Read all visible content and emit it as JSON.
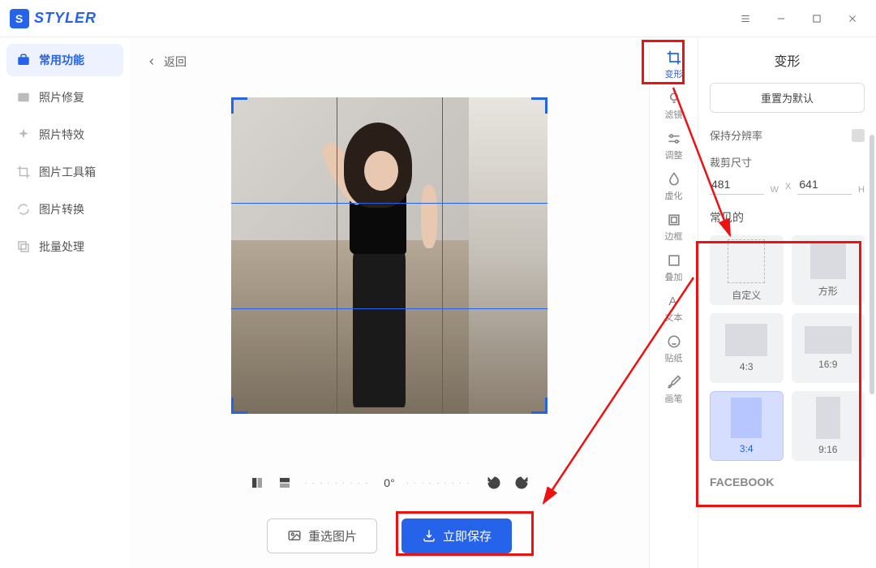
{
  "app": {
    "name": "STYLER",
    "logo_letter": "S"
  },
  "sidebar": {
    "items": [
      {
        "label": "常用功能"
      },
      {
        "label": "照片修复"
      },
      {
        "label": "照片特效"
      },
      {
        "label": "图片工具箱"
      },
      {
        "label": "图片转换"
      },
      {
        "label": "批量处理"
      }
    ]
  },
  "back_label": "返回",
  "rotation": {
    "angle": "0°"
  },
  "actions": {
    "reselect": "重选图片",
    "save": "立即保存"
  },
  "toolstrip": {
    "items": [
      {
        "label": "变形"
      },
      {
        "label": "滤镜"
      },
      {
        "label": "调整"
      },
      {
        "label": "虚化"
      },
      {
        "label": "边框"
      },
      {
        "label": "叠加"
      },
      {
        "label": "文本"
      },
      {
        "label": "贴纸"
      },
      {
        "label": "画笔"
      }
    ]
  },
  "panel": {
    "title": "变形",
    "reset": "重置为默认",
    "keep_res": "保持分辨率",
    "crop_label": "裁剪尺寸",
    "width": "481",
    "w_unit": "W",
    "x": "X",
    "height": "641",
    "h_unit": "H",
    "common": "常见的",
    "ratios": [
      {
        "label": "自定义"
      },
      {
        "label": "方形"
      },
      {
        "label": "4:3"
      },
      {
        "label": "16:9"
      },
      {
        "label": "3:4"
      },
      {
        "label": "9:16"
      }
    ],
    "facebook": "FACEBOOK"
  }
}
